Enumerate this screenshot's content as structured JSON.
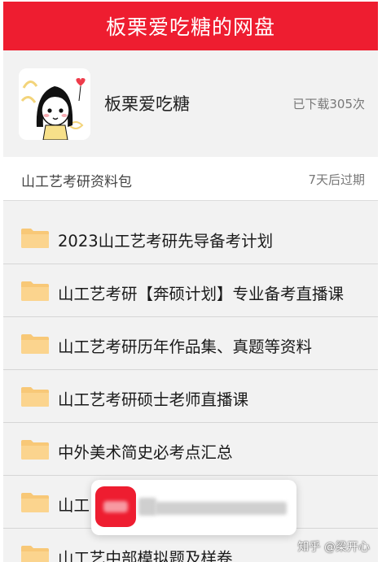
{
  "header": {
    "title": "板栗爱吃糖的网盘"
  },
  "profile": {
    "avatar_icon": "cartoon-girl-avatar-icon",
    "name": "板栗爱吃糖",
    "download_count": "已下载305次"
  },
  "package": {
    "name": "山工艺考研资料包",
    "expiry": "7天后过期"
  },
  "files": [
    {
      "label": "2023山工艺考研先导备考计划",
      "icon": "folder-icon"
    },
    {
      "label": "山工艺考研【奔硕计划】专业备考直播课",
      "icon": "folder-icon"
    },
    {
      "label": "山工艺考研历年作品集、真题等资料",
      "icon": "folder-icon"
    },
    {
      "label": "山工艺考研硕士老师直播课",
      "icon": "folder-icon"
    },
    {
      "label": "中外美术简史必考点汇总",
      "icon": "folder-icon"
    },
    {
      "label": "山工",
      "icon": "folder-icon"
    },
    {
      "label": "山工艺中部模拟题及样卷",
      "icon": "folder-icon"
    }
  ],
  "watermark": {
    "text": "知乎 @梁开心"
  },
  "colors": {
    "brand": "#ee1d30",
    "folder": "#f8c877",
    "background": "#f2f2f2"
  }
}
